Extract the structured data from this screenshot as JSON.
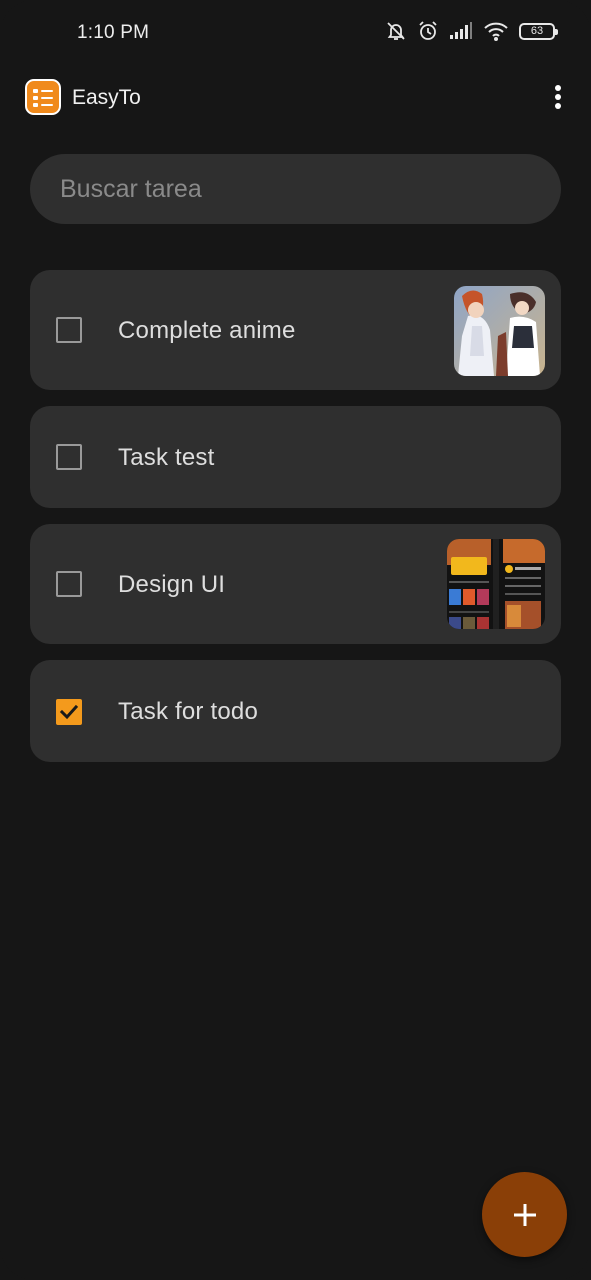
{
  "status_bar": {
    "time": "1:10 PM",
    "battery": "63",
    "icons": [
      "bell-off-icon",
      "alarm-icon",
      "signal-icon",
      "wifi-icon",
      "battery-icon"
    ]
  },
  "app_bar": {
    "title": "EasyTo",
    "logo_icon": "checklist-icon",
    "menu_icon": "more-vert-icon"
  },
  "search": {
    "placeholder": "Buscar tarea",
    "value": ""
  },
  "tasks": [
    {
      "label": "Complete anime",
      "checked": false,
      "has_image": true
    },
    {
      "label": "Task test",
      "checked": false,
      "has_image": false
    },
    {
      "label": "Design UI",
      "checked": false,
      "has_image": true
    },
    {
      "label": "Task for todo",
      "checked": true,
      "has_image": false
    }
  ],
  "fab": {
    "icon": "plus-icon"
  },
  "colors": {
    "background": "#161616",
    "surface": "#2f2f2f",
    "accent": "#f49a1c",
    "fab": "#8a3f07"
  }
}
